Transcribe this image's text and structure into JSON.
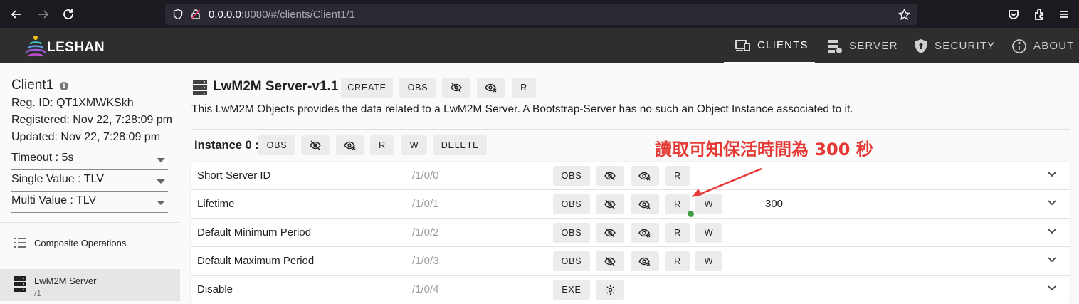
{
  "browser": {
    "url_host": "0.0.0.0",
    "url_rest": ":8080/#/clients/Client1/1"
  },
  "appbar": {
    "logo_text": "LESHAN",
    "nav": [
      {
        "label": "CLIENTS",
        "active": true
      },
      {
        "label": "SERVER",
        "active": false
      },
      {
        "label": "SECURITY",
        "active": false
      },
      {
        "label": "ABOUT",
        "active": false
      }
    ]
  },
  "sidebar": {
    "client_name": "Client1",
    "reg_id": "Reg. ID: QT1XMWKSkh",
    "registered": "Registered: Nov 22, 7:28:09 pm",
    "updated": "Updated: Nov 22, 7:28:09 pm",
    "timeout": "Timeout : 5s",
    "single_value": "Single Value : TLV",
    "multi_value": "Multi Value : TLV",
    "composite": "Composite Operations",
    "object_name": "LwM2M Server",
    "object_path": "/1"
  },
  "object": {
    "title": "LwM2M Server-v1.1",
    "buttons": {
      "create": "CREATE",
      "obs": "OBS",
      "read": "R"
    },
    "description": "This LwM2M Objects provides the data related to a LwM2M Server. A Bootstrap-Server has no such an Object Instance associated to it."
  },
  "instance": {
    "title": "Instance 0 :",
    "buttons": {
      "obs": "OBS",
      "read": "R",
      "write": "W",
      "delete": "DELETE"
    }
  },
  "resources": [
    {
      "name": "Short Server ID",
      "path": "/1/0/0",
      "obs": "OBS",
      "read": "R",
      "write": "",
      "value": ""
    },
    {
      "name": "Lifetime",
      "path": "/1/0/1",
      "obs": "OBS",
      "read": "R",
      "write": "W",
      "value": "300"
    },
    {
      "name": "Default Minimum Period",
      "path": "/1/0/2",
      "obs": "OBS",
      "read": "R",
      "write": "W",
      "value": ""
    },
    {
      "name": "Default Maximum Period",
      "path": "/1/0/3",
      "obs": "OBS",
      "read": "R",
      "write": "W",
      "value": ""
    },
    {
      "name": "Disable",
      "path": "/1/0/4",
      "exe": "EXE",
      "value": ""
    }
  ],
  "annotation": {
    "text": "讀取可知保活時間為 300 秒",
    "color": "#e53935"
  }
}
